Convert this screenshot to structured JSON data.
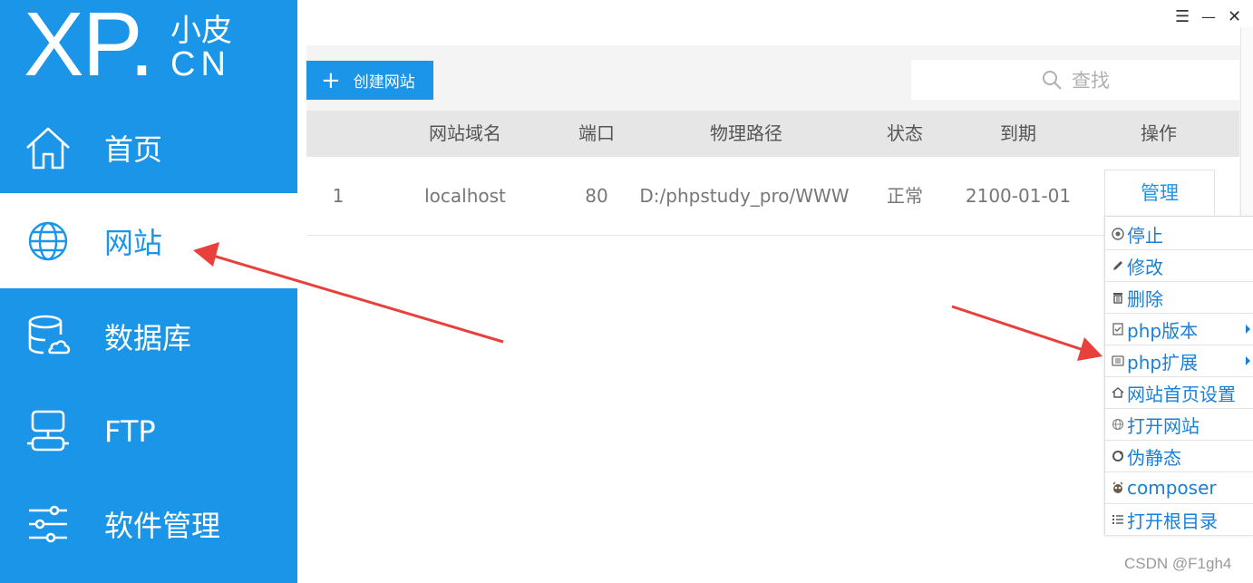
{
  "logo": {
    "mark": "XP.",
    "small_top": "小皮",
    "small_bottom": "CN"
  },
  "window_controls": {
    "menu": "☰",
    "minimize": "—",
    "close": "✕"
  },
  "sidebar": {
    "items": [
      {
        "label": "首页",
        "icon": "home-icon"
      },
      {
        "label": "网站",
        "icon": "globe-icon",
        "active": true
      },
      {
        "label": "数据库",
        "icon": "database-icon"
      },
      {
        "label": "FTP",
        "icon": "ftp-icon"
      },
      {
        "label": "软件管理",
        "icon": "sliders-icon"
      }
    ]
  },
  "toolbar": {
    "create_label": "创建网站",
    "plus": "+",
    "search_placeholder": "查找"
  },
  "table": {
    "columns": [
      "网站域名",
      "端口",
      "物理路径",
      "状态",
      "到期",
      "操作"
    ],
    "rows": [
      {
        "index": "1",
        "domain": "localhost",
        "port": "80",
        "path": "D:/phpstudy_pro/WWW",
        "status": "正常",
        "expiry": "2100-01-01",
        "action": "管理"
      }
    ]
  },
  "context_menu": {
    "items": [
      {
        "label": "停止",
        "icon": "stop-icon"
      },
      {
        "label": "修改",
        "icon": "edit-icon"
      },
      {
        "label": "删除",
        "icon": "trash-icon"
      },
      {
        "label": "php版本",
        "icon": "php-version-icon",
        "submenu": true
      },
      {
        "label": "php扩展",
        "icon": "php-extension-icon",
        "submenu": true
      },
      {
        "label": "网站首页设置",
        "icon": "home-small-icon"
      },
      {
        "label": "打开网站",
        "icon": "globe-small-icon"
      },
      {
        "label": "伪静态",
        "icon": "refresh-icon"
      },
      {
        "label": "composer",
        "icon": "composer-icon"
      },
      {
        "label": "打开根目录",
        "icon": "list-icon"
      }
    ]
  },
  "watermark": "CSDN @F1gh4",
  "colors": {
    "brand": "#1a95e8",
    "annotation_arrow": "#e8403a"
  }
}
